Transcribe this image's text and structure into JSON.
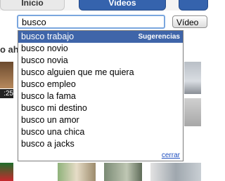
{
  "tabs": {
    "inicio": "Inicio",
    "videos": "Videos"
  },
  "search": {
    "value": "busco",
    "button_label": "Vídeo"
  },
  "page": {
    "section_heading": "o aho",
    "thumb_duration": ":25"
  },
  "suggestions": {
    "header_hint": "Sugerencias",
    "close_label": "cerrar",
    "selected_index": 0,
    "items": [
      "busco trabajo",
      "busco novio",
      "busco novia",
      "busco alguien que me quiera",
      "busco empleo",
      "busco la fama",
      "busco mi destino",
      "busco un amor",
      "busco una chica",
      "busco a jacks"
    ]
  },
  "colors": {
    "selected_bg": "#3f65a9",
    "input_border": "#7aa6de",
    "link": "#1f4fbf"
  }
}
